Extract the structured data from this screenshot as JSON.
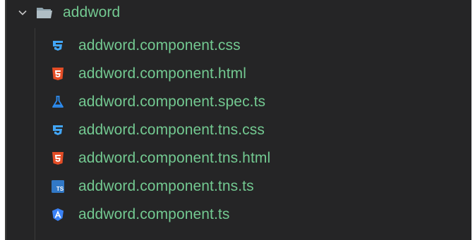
{
  "explorer": {
    "folder": {
      "name": "addword",
      "expanded": true,
      "icon": "folder-open-icon",
      "chevron": "chevron-down-icon"
    },
    "files": [
      {
        "name": "addword.component.css",
        "icon": "css-icon",
        "color": "#42a5f5"
      },
      {
        "name": "addword.component.html",
        "icon": "html-icon",
        "color": "#e44d26"
      },
      {
        "name": "addword.component.spec.ts",
        "icon": "test-flask-icon",
        "color": "#2d8cf0"
      },
      {
        "name": "addword.component.tns.css",
        "icon": "css-icon",
        "color": "#42a5f5"
      },
      {
        "name": "addword.component.tns.html",
        "icon": "html-icon",
        "color": "#e44d26"
      },
      {
        "name": "addword.component.tns.ts",
        "icon": "typescript-icon",
        "color": "#3178c6"
      },
      {
        "name": "addword.component.ts",
        "icon": "angular-icon",
        "color": "#3b82f6"
      }
    ],
    "colors": {
      "background": "#252526",
      "label": "#73c991"
    }
  }
}
